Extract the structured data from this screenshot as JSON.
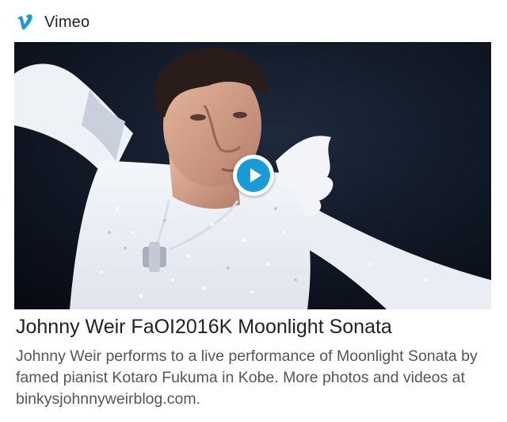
{
  "provider": {
    "name": "Vimeo",
    "logo_icon": "vimeo-v-icon",
    "accent_color": "#1a9ad6"
  },
  "video": {
    "title": "Johnny Weir FaOI2016K Moonlight Sonata",
    "description": "Johnny Weir performs to a live performance of Moonlight Sonata by famed pianist Kotaro Fukuma in Kobe. More photos and videos at binkysjohnnyweirblog.com.",
    "play_icon": "play-icon"
  }
}
